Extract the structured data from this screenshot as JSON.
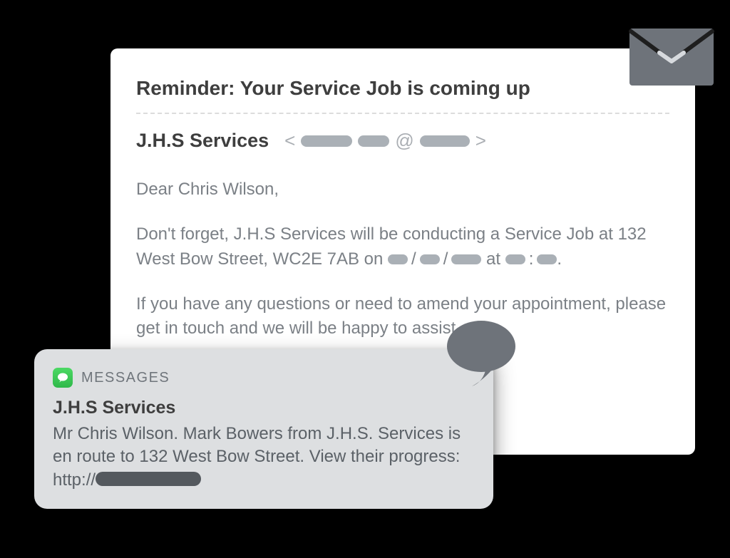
{
  "email": {
    "subject": "Reminder: Your Service Job is coming up",
    "sender_name": "J.H.S Services",
    "sender_prefix": "<",
    "sender_at": "@",
    "sender_suffix": ">",
    "greeting": "Dear Chris Wilson,",
    "p1a": "Don't forget, J.H.S Services will be conducting a Service Job at 132 West Bow Street, WC2E 7AB on ",
    "slash": "/",
    "p1b": " at ",
    "colon": ":",
    "period": ".",
    "p2": "If you have any questions or need to amend your appointment, please get in touch and we will be happy to assist."
  },
  "sms": {
    "app_label": "MESSAGES",
    "sender": "J.H.S Services",
    "body_a": "Mr Chris Wilson. Mark Bowers from J.H.S. Services is en route to 132 West Bow Street. View their progress: http://"
  },
  "colors": {
    "bg": "#000000",
    "card": "#ffffff",
    "text_heading": "#3e3e3e",
    "text_body": "#7b8086",
    "redact": "#aab0b6",
    "sms_card": "#dddfe1",
    "envelope": "#6e737a",
    "messages_green": "#2fb84a"
  }
}
